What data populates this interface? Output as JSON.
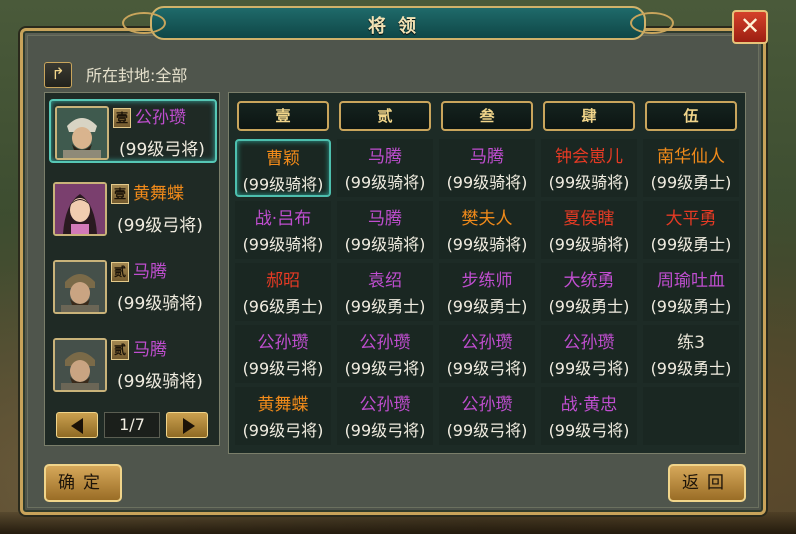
{
  "dialog": {
    "title": "将领",
    "close_label": "✕",
    "location_label": "所在封地:全部"
  },
  "colors": {
    "name_purple": "#c04ed0",
    "name_orange": "#f08a1a",
    "name_red": "#e43a24",
    "name_white": "#e8e4d6",
    "selection_teal": "#4dbfae"
  },
  "generals": [
    {
      "name": "公孙瓒",
      "level": "(99级弓将)",
      "rank": "壹",
      "color": "#c04ed0",
      "selected": true,
      "portrait": "armored-general"
    },
    {
      "name": "黄舞蝶",
      "level": "(99级弓将)",
      "rank": "壹",
      "color": "#f08a1a",
      "selected": false,
      "portrait": "female-general"
    },
    {
      "name": "马腾",
      "level": "(99级骑将)",
      "rank": "贰",
      "color": "#c04ed0",
      "selected": false,
      "portrait": "helmet-general"
    },
    {
      "name": "马腾",
      "level": "(99级骑将)",
      "rank": "贰",
      "color": "#c04ed0",
      "selected": false,
      "portrait": "helmet-general"
    }
  ],
  "pager": {
    "page": "1/7"
  },
  "columns": [
    "壹",
    "贰",
    "叁",
    "肆",
    "伍"
  ],
  "grid": [
    [
      {
        "name": "曹颖",
        "level": "(99级骑将)",
        "color": "#f08a1a",
        "selected": true
      },
      {
        "name": "马腾",
        "level": "(99级骑将)",
        "color": "#c04ed0"
      },
      {
        "name": "马腾",
        "level": "(99级骑将)",
        "color": "#c04ed0"
      },
      {
        "name": "钟会崽儿",
        "level": "(99级骑将)",
        "color": "#e43a24"
      },
      {
        "name": "南华仙人",
        "level": "(99级勇士)",
        "color": "#f08a1a"
      }
    ],
    [
      {
        "name": "战·吕布",
        "level": "(99级骑将)",
        "color": "#c04ed0"
      },
      {
        "name": "马腾",
        "level": "(99级骑将)",
        "color": "#c04ed0"
      },
      {
        "name": "樊夫人",
        "level": "(99级骑将)",
        "color": "#f08a1a"
      },
      {
        "name": "夏侯瞎",
        "level": "(99级骑将)",
        "color": "#e43a24"
      },
      {
        "name": "大平勇",
        "level": "(99级勇士)",
        "color": "#e43a24"
      }
    ],
    [
      {
        "name": "郝昭",
        "level": "(96级勇士)",
        "color": "#e43a24"
      },
      {
        "name": "袁绍",
        "level": "(99级勇士)",
        "color": "#c04ed0"
      },
      {
        "name": "步练师",
        "level": "(99级勇士)",
        "color": "#c04ed0"
      },
      {
        "name": "大统勇",
        "level": "(99级勇士)",
        "color": "#c04ed0"
      },
      {
        "name": "周瑜吐血",
        "level": "(99级勇士)",
        "color": "#c04ed0"
      }
    ],
    [
      {
        "name": "公孙瓒",
        "level": "(99级弓将)",
        "color": "#c04ed0"
      },
      {
        "name": "公孙瓒",
        "level": "(99级弓将)",
        "color": "#c04ed0"
      },
      {
        "name": "公孙瓒",
        "level": "(99级弓将)",
        "color": "#c04ed0"
      },
      {
        "name": "公孙瓒",
        "level": "(99级弓将)",
        "color": "#c04ed0"
      },
      {
        "name": "练3",
        "level": "(99级勇士)",
        "color": "#e8e4d6"
      }
    ],
    [
      {
        "name": "黄舞蝶",
        "level": "(99级弓将)",
        "color": "#f08a1a"
      },
      {
        "name": "公孙瓒",
        "level": "(99级弓将)",
        "color": "#c04ed0"
      },
      {
        "name": "公孙瓒",
        "level": "(99级弓将)",
        "color": "#c04ed0"
      },
      {
        "name": "战·黄忠",
        "level": "(99级弓将)",
        "color": "#c04ed0"
      },
      {
        "name": "",
        "level": "",
        "color": "#e8e4d6"
      }
    ]
  ],
  "buttons": {
    "confirm": "确定",
    "back": "返回"
  }
}
